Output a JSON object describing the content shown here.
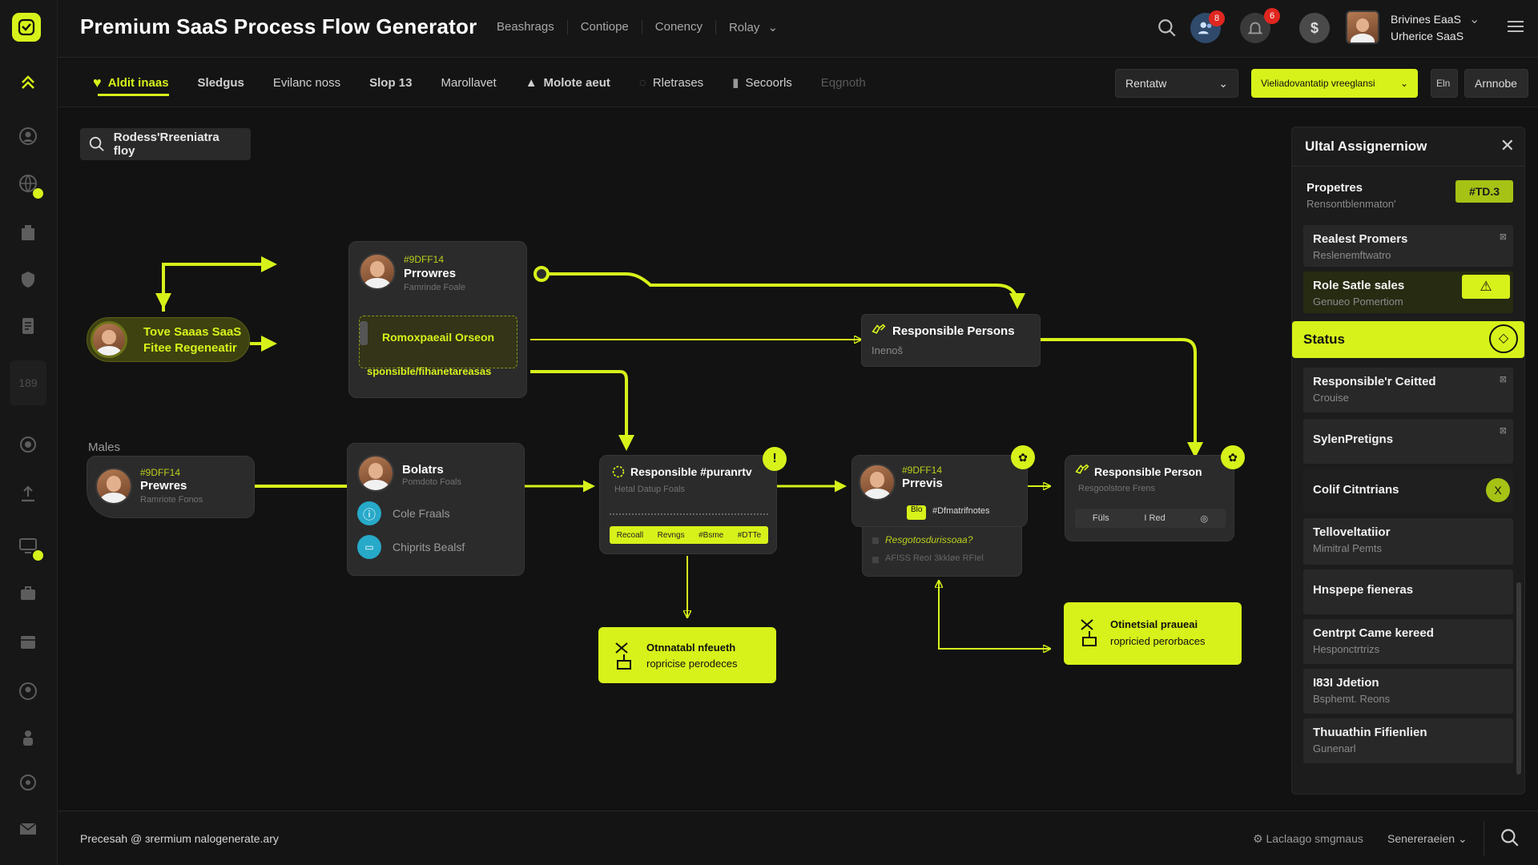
{
  "app": {
    "title": "Premium SaaS Process Flow Generator"
  },
  "topnav": [
    "Beashrags",
    "Contiope",
    "Conency",
    "Rolay"
  ],
  "notifications": {
    "users_badge": "8",
    "bell_badge": "6",
    "coin_label": "$"
  },
  "user": {
    "name": "Brivines EaaS",
    "role": "Urherice SaaS"
  },
  "tabs": [
    "Aldit inaas",
    "Sledgus",
    "Evilanc noss",
    "Slop 13",
    "Marollavet",
    "Molote aeut",
    "Rletrases",
    "Secoorls",
    "Eqgnoth"
  ],
  "controls": {
    "dropdown": "Rentatw",
    "highlight_dropdown": "Vieliadovantatip vreeglansi",
    "small_button": "Eln",
    "button": "Arnnobe"
  },
  "search": {
    "value": "Rodess'Rreeniatra floy"
  },
  "colors": {
    "accent": "#d7f21a",
    "background": "#121212",
    "panel": "#2b2b2b"
  },
  "flow": {
    "start": {
      "line1": "Tove Saaas SaaS",
      "line2": "Fitee Regeneatir"
    },
    "node_top": {
      "hex": "#9DFF14",
      "name": "Prrowres",
      "sub": "Famrinde Foale",
      "highlight": "Romoxpaeail Orseon",
      "caption": "sponsible/fihanetareasas"
    },
    "males_label": "Males",
    "node_males": {
      "hex": "#9DFF14",
      "name": "Prewres",
      "sub": "Ramriote Fonos"
    },
    "responsible_top": {
      "title": "Responsible Persons",
      "sub": "Inenoš"
    },
    "node_bolatrs": {
      "name": "Bolatrs",
      "sub": "Pomdoto Foals",
      "item1": "Cole Fraals",
      "item2": "Chiprits Bealsf"
    },
    "node_center": {
      "title": "Responsible #puranrtv",
      "sub": "Hetal Datup Foals",
      "chips": [
        "Recoall",
        "Revngs",
        "#Bsme",
        "#DTTe"
      ]
    },
    "output_left": {
      "line1": "Otnnatabl nfeueth",
      "line2": "ropricise perodeces"
    },
    "node_person2": {
      "hex": "#9DFF14",
      "name": "Prrevis",
      "chip_tag": "Blo",
      "chip_text": "#Dfmatrifnotes",
      "line1": "Resgotosdurissoaa?",
      "line2": "AFISS ReoI 3kkløe RFIel"
    },
    "node_right": {
      "title": "Responsible Person",
      "sub": "Resgoolstore Frens",
      "chips": [
        "Füls",
        "I Red",
        "◎"
      ]
    },
    "output_right": {
      "line1": "Otinetsial praueai",
      "line2": "ropricied perorbaces"
    }
  },
  "panel": {
    "title": "Ultal Assignerniow",
    "properties": {
      "title": "Propetres",
      "sub": "Rensontblenmaton'",
      "badge": "#TD.3"
    },
    "rows": [
      {
        "title": "Realest Promers",
        "sub": "Reslenemftwatro"
      },
      {
        "title": "Role Satle sales",
        "sub": "Genueo Pomertiom"
      }
    ],
    "status": "Status",
    "items": [
      {
        "title": "Responsible'r Ceitted",
        "sub": "Crouise"
      },
      {
        "title": "SylenPretigns",
        "sub": ""
      },
      {
        "title": "Colif Citntrians",
        "sub": ""
      },
      {
        "title": "Telloveltatiior",
        "sub": "Mimitral Pemts"
      },
      {
        "title": "Hnspepe fieneras",
        "sub": ""
      },
      {
        "title": "Centrpt Came kereed",
        "sub": "Hesponctrtrizs"
      },
      {
        "title": "I83I Jdetion",
        "sub": "Bsphemt. Reons"
      },
      {
        "title": "Thuuathin Fifienlien",
        "sub": "Gunenarl"
      }
    ]
  },
  "footer": {
    "left": "Precesah @ ɜrermium nalogenerate.ary",
    "middle": "Laclaago smgmaus",
    "right": "Senereraeien"
  },
  "sidebar": {
    "badge": "189"
  }
}
